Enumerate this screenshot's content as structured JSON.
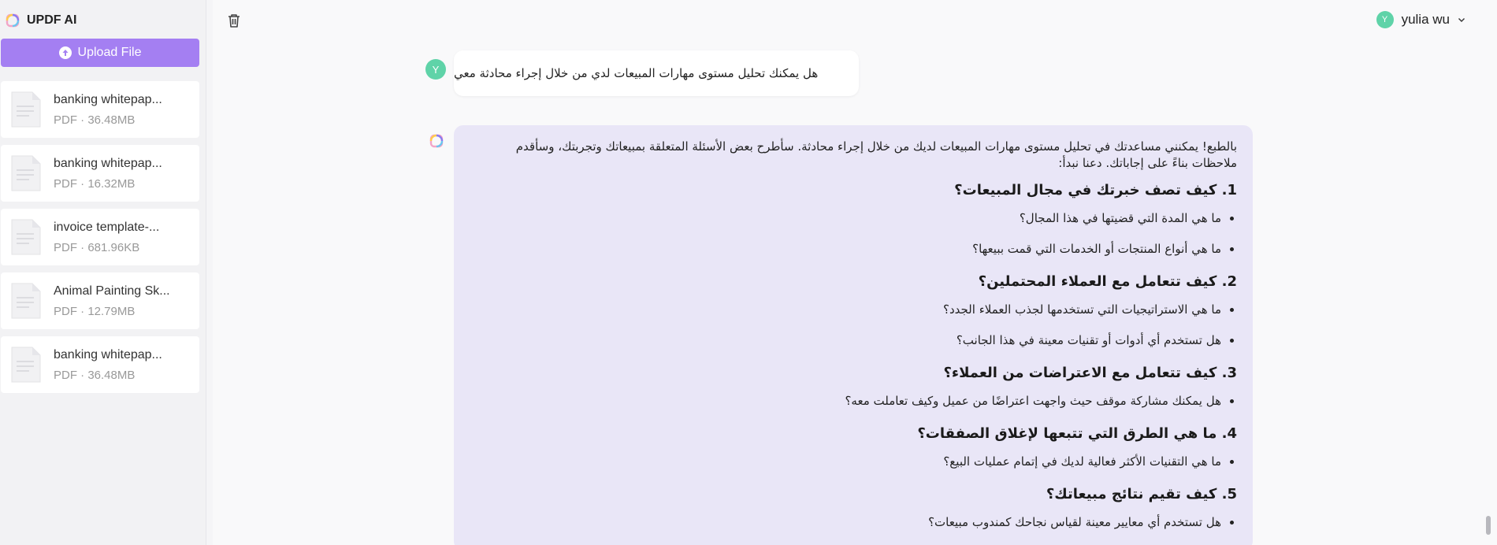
{
  "app": {
    "name": "UPDF AI"
  },
  "sidebar": {
    "upload_label": "Upload File",
    "files": [
      {
        "name": "banking whitepap...",
        "meta": "PDF · 36.48MB"
      },
      {
        "name": "banking whitepap...",
        "meta": "PDF · 16.32MB"
      },
      {
        "name": "invoice template-...",
        "meta": "PDF · 681.96KB"
      },
      {
        "name": "Animal Painting Sk...",
        "meta": "PDF · 12.79MB"
      },
      {
        "name": "banking whitepap...",
        "meta": "PDF · 36.48MB"
      }
    ]
  },
  "header": {
    "user": {
      "initial": "Y",
      "name": "yulia wu"
    }
  },
  "chat": {
    "user_initial": "Y",
    "user_message": "هل يمكنك تحليل مستوى مهارات المبيعات لدي من خلال إجراء محادثة معي",
    "ai_intro": "بالطبع! يمكنني مساعدتك في تحليل مستوى مهارات المبيعات لديك من خلال إجراء محادثة. سأطرح بعض الأسئلة المتعلقة بمبيعاتك وتجربتك، وسأقدم ملاحظات بناءً على إجاباتك. دعنا نبدأ:",
    "sections": [
      {
        "heading": "1. كيف تصف خبرتك في مجال المبيعات؟",
        "items": [
          "ما هي المدة التي قضيتها في هذا المجال؟",
          "ما هي أنواع المنتجات أو الخدمات التي قمت ببيعها؟"
        ]
      },
      {
        "heading": "2. كيف تتعامل مع العملاء المحتملين؟",
        "items": [
          "ما هي الاستراتيجيات التي تستخدمها لجذب العملاء الجدد؟",
          "هل تستخدم أي أدوات أو تقنيات معينة في هذا الجانب؟"
        ]
      },
      {
        "heading": "3. كيف تتعامل مع الاعتراضات من العملاء؟",
        "items": [
          "هل يمكنك مشاركة موقف حيث واجهت اعتراضًا من عميل وكيف تعاملت معه؟"
        ]
      },
      {
        "heading": "4. ما هي الطرق التي تتبعها لإغلاق الصفقات؟",
        "items": [
          "ما هي التقنيات الأكثر فعالية لديك في إتمام عمليات البيع؟"
        ]
      },
      {
        "heading": "5. كيف تقيم نتائج مبيعاتك؟",
        "items": [
          "هل تستخدم أي معايير معينة لقياس نجاحك كمندوب مبيعات؟"
        ]
      }
    ]
  },
  "colors": {
    "accent": "#a47ff2",
    "avatar": "#5fd3a8",
    "ai_bubble": "#e9e6f7"
  }
}
